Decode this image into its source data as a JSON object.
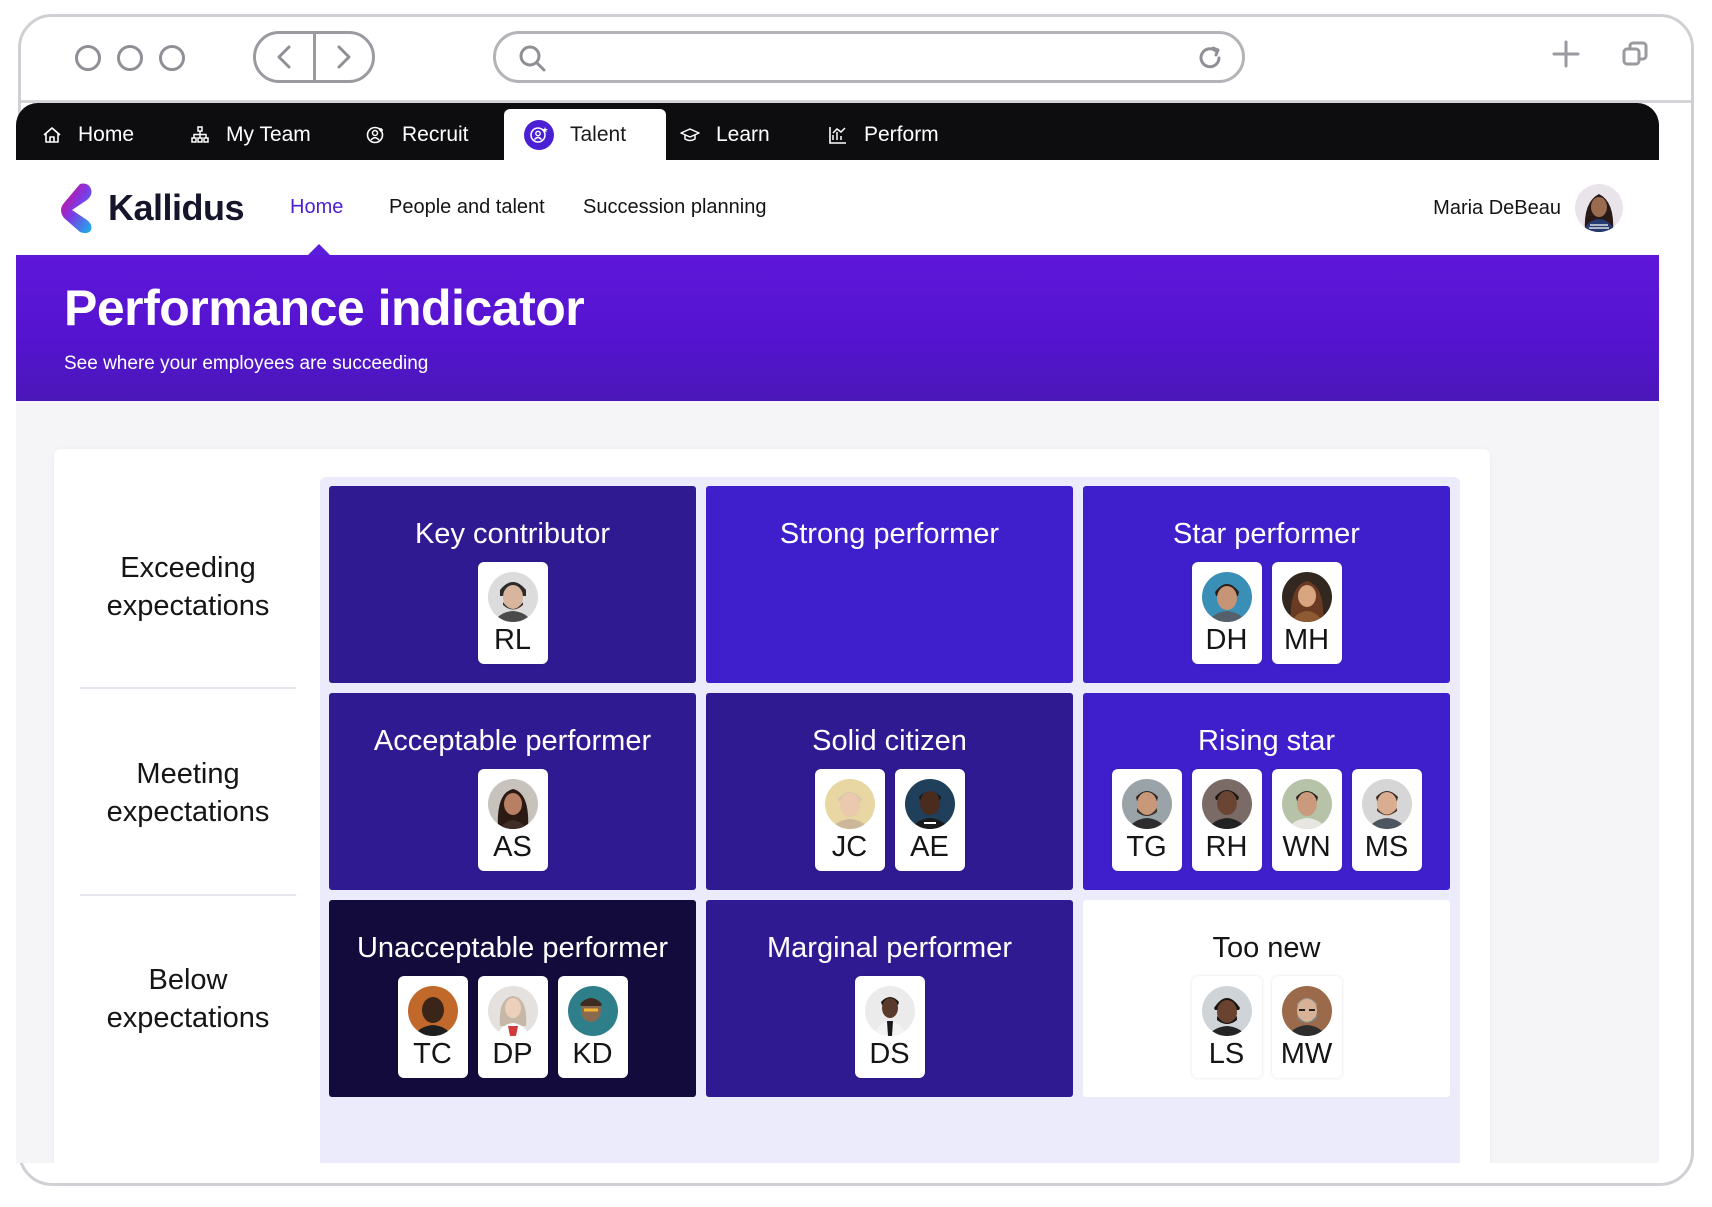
{
  "top_nav": {
    "tabs": [
      {
        "label": "Home",
        "icon": "home-icon"
      },
      {
        "label": "My Team",
        "icon": "org-chart-icon"
      },
      {
        "label": "Recruit",
        "icon": "recruit-icon"
      },
      {
        "label": "Talent",
        "icon": "talent-icon"
      },
      {
        "label": "Learn",
        "icon": "graduation-cap-icon"
      },
      {
        "label": "Perform",
        "icon": "chart-icon"
      }
    ]
  },
  "sub_nav": {
    "brand": "Kallidus",
    "links": [
      "Home",
      "People and talent",
      "Succession planning"
    ],
    "user_name": "Maria DeBeau"
  },
  "banner": {
    "title": "Performance indicator",
    "subtitle": "See where your employees are succeeding"
  },
  "rows": [
    "Exceeding expectations",
    "Meeting expectations",
    "Below expectations"
  ],
  "cells": [
    {
      "title": "Key contributor",
      "people": [
        "RL"
      ]
    },
    {
      "title": "Strong performer",
      "people": []
    },
    {
      "title": "Star performer",
      "people": [
        "DH",
        "MH"
      ]
    },
    {
      "title": "Acceptable performer",
      "people": [
        "AS"
      ]
    },
    {
      "title": "Solid citizen",
      "people": [
        "JC",
        "AE"
      ]
    },
    {
      "title": "Rising star",
      "people": [
        "TG",
        "RH",
        "WN",
        "MS"
      ]
    },
    {
      "title": "Unacceptable performer",
      "people": [
        "TC",
        "DP",
        "KD"
      ]
    },
    {
      "title": "Marginal performer",
      "people": [
        "DS"
      ]
    },
    {
      "title": "Too new",
      "people": [
        "LS",
        "MW"
      ]
    }
  ],
  "colors": {
    "accent": "#4b1fd3",
    "cell_dark_navy": "#301a91",
    "cell_violet": "#3f1fcc",
    "cell_deep": "#120b3c"
  }
}
